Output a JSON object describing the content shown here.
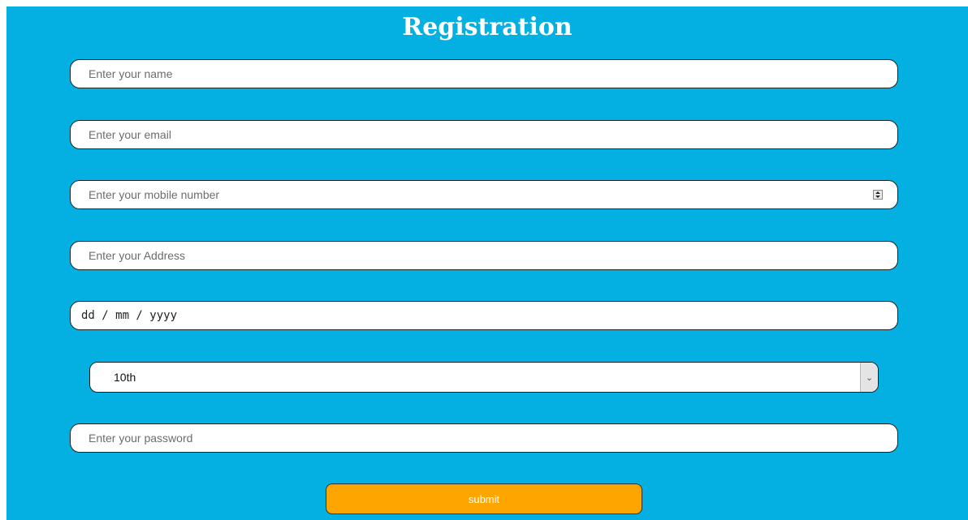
{
  "form": {
    "title": "Registration",
    "name_placeholder": "Enter your name",
    "email_placeholder": "Enter your email",
    "mobile_placeholder": "Enter your mobile number",
    "address_placeholder": "Enter your Address",
    "date_placeholder": "dd / mm / yyyy",
    "qualification_selected": "10th",
    "password_placeholder": "Enter your password",
    "submit_label": "submit"
  },
  "colors": {
    "background": "#03b0e1",
    "submit": "#ffa500"
  },
  "icons": {
    "spinner": "number-spinner-icon",
    "dropdown": "chevron-down-icon"
  }
}
